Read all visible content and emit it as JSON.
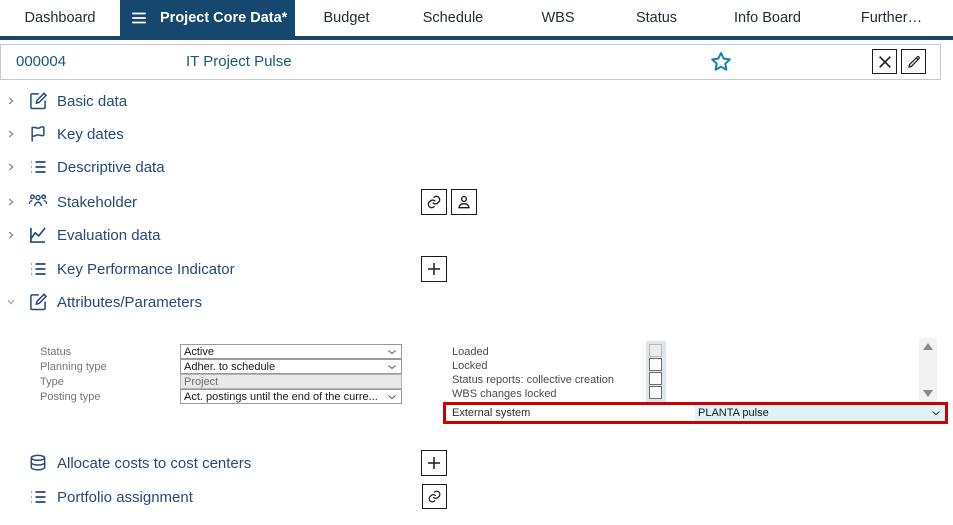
{
  "tabs": [
    {
      "label": "Dashboard",
      "active": false
    },
    {
      "label": "Project Core Data*",
      "active": true
    },
    {
      "label": "Budget",
      "active": false
    },
    {
      "label": "Schedule",
      "active": false
    },
    {
      "label": "WBS",
      "active": false
    },
    {
      "label": "Status",
      "active": false
    },
    {
      "label": "Info Board",
      "active": false
    },
    {
      "label": "Further…",
      "active": false
    }
  ],
  "header": {
    "project_id": "000004",
    "project_name": "IT Project Pulse"
  },
  "sections": [
    {
      "label": "Basic data",
      "icon": "edit-icon",
      "state": "collapsed"
    },
    {
      "label": "Key dates",
      "icon": "flag-icon",
      "state": "collapsed"
    },
    {
      "label": "Descriptive data",
      "icon": "list-icon",
      "state": "collapsed"
    },
    {
      "label": "Stakeholder",
      "icon": "people-icon",
      "state": "collapsed"
    },
    {
      "label": "Evaluation data",
      "icon": "chart-icon",
      "state": "collapsed"
    },
    {
      "label": "Key Performance Indicator",
      "icon": "list-icon",
      "state": "none"
    },
    {
      "label": "Attributes/Parameters",
      "icon": "edit-icon",
      "state": "expanded"
    },
    {
      "label": "Allocate costs to cost centers",
      "icon": "database-icon",
      "state": "none"
    },
    {
      "label": "Portfolio assignment",
      "icon": "list-icon",
      "state": "none"
    }
  ],
  "form": {
    "fields": [
      {
        "label": "Status",
        "value": "Active",
        "type": "select"
      },
      {
        "label": "Planning type",
        "value": "Adher. to schedule",
        "type": "select"
      },
      {
        "label": "Type",
        "value": "Project",
        "type": "readonly"
      },
      {
        "label": "Posting type",
        "value": "Act. postings until the end of the curre...",
        "type": "select"
      }
    ],
    "checkboxes": [
      {
        "label": "Loaded",
        "checked": false,
        "disabled": true
      },
      {
        "label": "Locked",
        "checked": false,
        "disabled": false
      },
      {
        "label": "Status reports: collective creation",
        "checked": false,
        "disabled": false
      },
      {
        "label": "WBS changes locked",
        "checked": false,
        "disabled": false
      }
    ],
    "external_system": {
      "label": "External system",
      "value": "PLANTA pulse"
    }
  },
  "colors": {
    "navy": "#15476F",
    "star_teal": "#1581AD",
    "section_text": "#254A78",
    "highlight_red": "#CC0000",
    "external_field_bg": "#DFF3F7"
  }
}
